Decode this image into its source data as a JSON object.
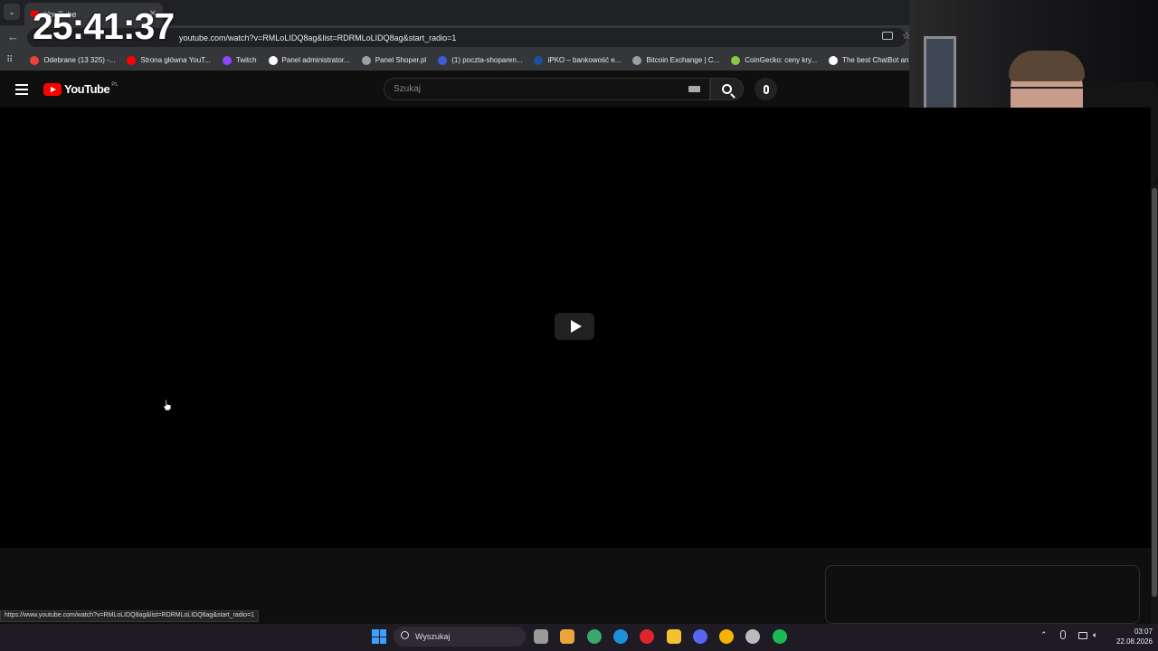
{
  "browser": {
    "tab_title": "YouTube",
    "tab_close": "✕",
    "address": "youtube.com/watch?v=RMLoLIDQ8ag&list=RDRMLoLIDQ8ag&start_radio=1",
    "bookmarks": [
      {
        "label": "Odebrane (13 325) -...",
        "color": "#ea4335"
      },
      {
        "label": "Strona główna YouT...",
        "color": "#ff0000"
      },
      {
        "label": "Twitch",
        "color": "#9146ff"
      },
      {
        "label": "Panel administrator...",
        "color": "#ffffff"
      },
      {
        "label": "Panel Shoper.pl",
        "color": "#9aa0a6"
      },
      {
        "label": "(1) poczta-shoparen...",
        "color": "#3b5bdb"
      },
      {
        "label": "iPKO – bankowość e...",
        "color": "#1c4e9c"
      },
      {
        "label": "Bitcoin Exchange | C...",
        "color": "#9aa0a6"
      },
      {
        "label": "CoinGecko: ceny kry...",
        "color": "#8dc63f"
      },
      {
        "label": "The best ChatBot an...",
        "color": "#ffffff"
      }
    ]
  },
  "overlay": {
    "timer": "25:41:37"
  },
  "youtube": {
    "logo_text": "YouTube",
    "region": "PL",
    "search_placeholder": "Szukaj"
  },
  "status_bar": {
    "url": "https://www.youtube.com/watch?v=RMLoLIDQ8ag&list=RDRMLoLIDQ8ag&start_radio=1"
  },
  "taskbar": {
    "search_label": "Wyszukaj",
    "apps": [
      {
        "name": "task-view-icon",
        "color": "#9a9a9a"
      },
      {
        "name": "store-icon",
        "color": "#e9a53a"
      },
      {
        "name": "app-icon",
        "color": "#3aa76d"
      },
      {
        "name": "edge-icon",
        "color": "#1e90d8"
      },
      {
        "name": "opera-icon",
        "color": "#e0242e"
      },
      {
        "name": "explorer-icon",
        "color": "#f2c230"
      },
      {
        "name": "discord-icon",
        "color": "#5865f2"
      },
      {
        "name": "chrome-icon",
        "color": "#f4b400"
      },
      {
        "name": "app-icon-2",
        "color": "#bbbbbb"
      },
      {
        "name": "spotify-icon",
        "color": "#1db954"
      }
    ],
    "time": "03:07",
    "date": "22.08.2026"
  }
}
